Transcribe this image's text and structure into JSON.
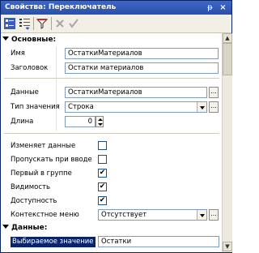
{
  "window": {
    "title": "Свойства: Переключатель",
    "pin_glyph": "ᵽ",
    "close_glyph": "×"
  },
  "toolbar": {
    "icons": [
      "categorized-view-icon",
      "sort-alpha-icon",
      "filter-icon",
      "cancel-icon",
      "apply-icon"
    ]
  },
  "sections": {
    "main": "Основные:",
    "data": "Данные:"
  },
  "properties": {
    "name_label": "Имя",
    "name_value": "ОстаткиМатериалов",
    "caption_label": "Заголовок",
    "caption_value": "Остатки материалов",
    "data_label": "Данные",
    "data_value": "ОстаткиМатериалов",
    "data_button": "...",
    "type_label": "Тип значения",
    "type_value": "Строка",
    "type_button": "...",
    "length_label": "Длина",
    "length_value": "0",
    "changes_data_label": "Изменяет данные",
    "changes_data_checked": false,
    "skip_on_input_label": "Пропускать при вводе",
    "skip_on_input_checked": false,
    "first_in_group_label": "Первый в группе",
    "first_in_group_checked": true,
    "visibility_label": "Видимость",
    "visibility_checked": true,
    "availability_label": "Доступность",
    "availability_checked": true,
    "context_menu_label": "Контекстное меню",
    "context_menu_value": "Отсутствует",
    "context_menu_button": "...",
    "selected_value_label": "Выбираемое значение",
    "selected_value_value": "Остатки"
  },
  "check_glyph": "✔"
}
